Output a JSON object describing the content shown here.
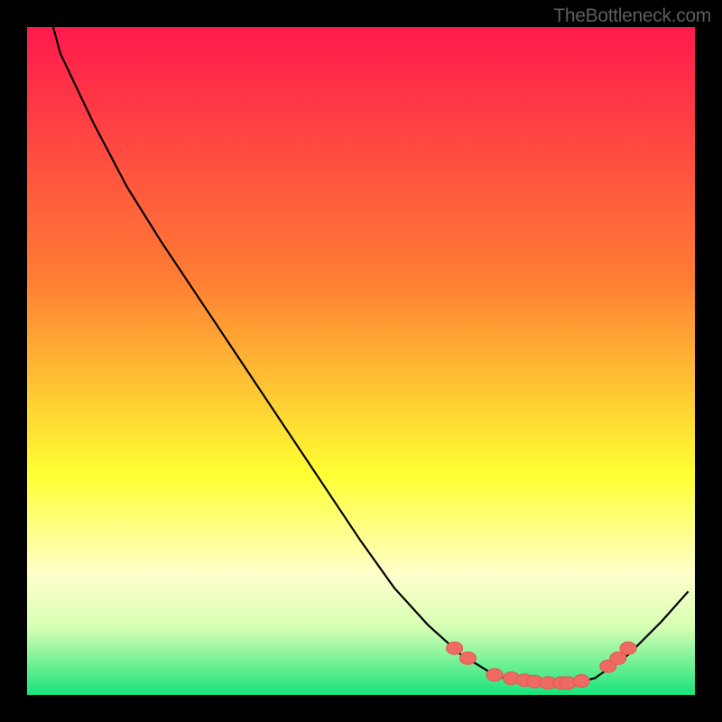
{
  "attribution": "TheBottleneck.com",
  "colors": {
    "frame": "#000000",
    "curve": "#000000",
    "marker_fill": "#ef6a62",
    "marker_stroke": "#dd5953",
    "grad_top": "#ff1a4d",
    "grad_mid1": "#ff7e33",
    "grad_mid2": "#ffff33",
    "grad_bottom_yellow": "#ffffcc",
    "grad_green_light": "#b8ff80",
    "grad_green": "#17e37a"
  },
  "chart_data": {
    "type": "line",
    "title": "",
    "xlabel": "",
    "ylabel": "",
    "xlim": [
      0,
      100
    ],
    "ylim": [
      0,
      100
    ],
    "curve": [
      {
        "x": 3.9,
        "y": 100
      },
      {
        "x": 5,
        "y": 96
      },
      {
        "x": 10,
        "y": 85.5
      },
      {
        "x": 15,
        "y": 76
      },
      {
        "x": 20,
        "y": 68
      },
      {
        "x": 25,
        "y": 60.5
      },
      {
        "x": 30,
        "y": 53
      },
      {
        "x": 35,
        "y": 45.5
      },
      {
        "x": 40,
        "y": 38
      },
      {
        "x": 45,
        "y": 30.5
      },
      {
        "x": 50,
        "y": 23
      },
      {
        "x": 55,
        "y": 16
      },
      {
        "x": 60,
        "y": 10.5
      },
      {
        "x": 65,
        "y": 6
      },
      {
        "x": 70,
        "y": 3
      },
      {
        "x": 75,
        "y": 1.5
      },
      {
        "x": 80,
        "y": 1.3
      },
      {
        "x": 85,
        "y": 2.5
      },
      {
        "x": 90,
        "y": 6
      },
      {
        "x": 95,
        "y": 11
      },
      {
        "x": 99,
        "y": 15.5
      }
    ],
    "markers": [
      {
        "x": 64,
        "y": 7
      },
      {
        "x": 66,
        "y": 5.5
      },
      {
        "x": 70,
        "y": 3
      },
      {
        "x": 72.5,
        "y": 2.5
      },
      {
        "x": 74.5,
        "y": 2.2
      },
      {
        "x": 76,
        "y": 2
      },
      {
        "x": 78,
        "y": 1.8
      },
      {
        "x": 80,
        "y": 1.8
      },
      {
        "x": 81,
        "y": 1.8
      },
      {
        "x": 83,
        "y": 2.1
      },
      {
        "x": 87,
        "y": 4.3
      },
      {
        "x": 88.5,
        "y": 5.5
      },
      {
        "x": 90,
        "y": 7
      }
    ]
  }
}
